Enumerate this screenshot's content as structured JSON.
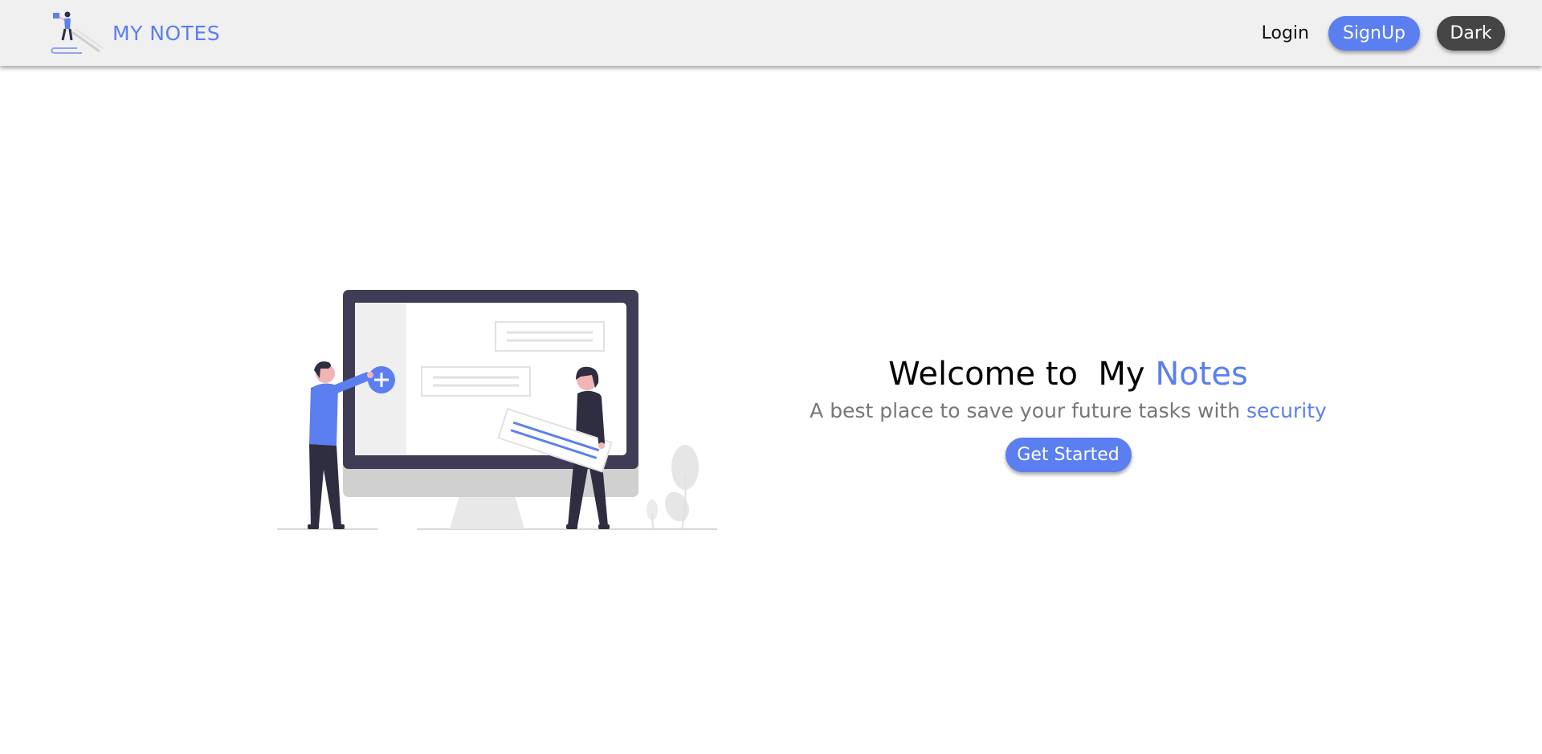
{
  "nav": {
    "brand": "MY NOTES",
    "login": "Login",
    "signup": "SignUp",
    "theme_toggle": "Dark"
  },
  "hero": {
    "title_prefix": "Welcome to",
    "title_my": "My",
    "title_notes": "Notes",
    "tagline_prefix": "A best place to save your future tasks with",
    "tagline_accent": "security",
    "cta": "Get Started"
  },
  "colors": {
    "accent": "#5b7ff0",
    "navbar_bg": "#f0f0f0",
    "dark_button": "#454545",
    "text_muted": "#777777"
  },
  "icons": {
    "brand_logo": "notes-logo-icon",
    "plus": "plus-icon"
  }
}
